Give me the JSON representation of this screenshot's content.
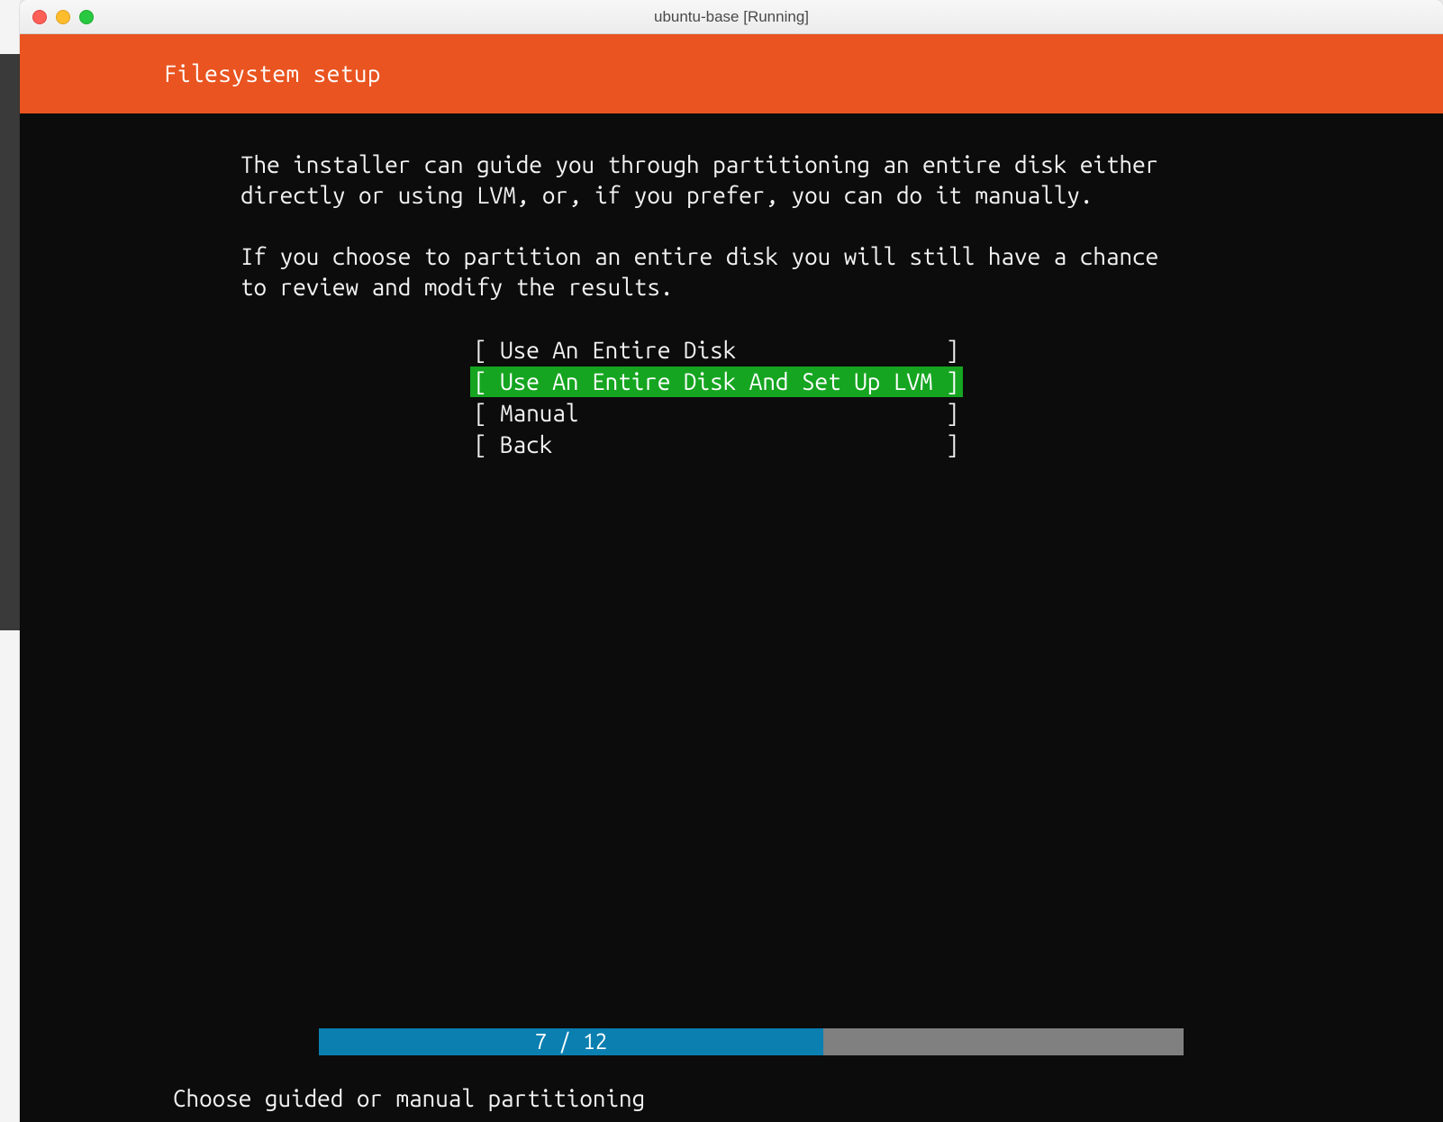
{
  "window": {
    "title": "ubuntu-base [Running]"
  },
  "header": {
    "title": "Filesystem setup"
  },
  "body": {
    "intro": "The installer can guide you through partitioning an entire disk either\ndirectly or using LVM, or, if you prefer, you can do it manually.\n\nIf you choose to partition an entire disk you will still have a chance\nto review and modify the results."
  },
  "menu": {
    "items": [
      {
        "label": "[ Use An Entire Disk                ]",
        "selected": false
      },
      {
        "label": "[ Use An Entire Disk And Set Up LVM ]",
        "selected": true
      },
      {
        "label": "[ Manual                            ]",
        "selected": false
      },
      {
        "label": "[ Back                              ]",
        "selected": false
      }
    ]
  },
  "progress": {
    "current": 7,
    "total": 12,
    "label": "7 / 12",
    "percent": 58.3
  },
  "hint": "Choose guided or manual partitioning"
}
